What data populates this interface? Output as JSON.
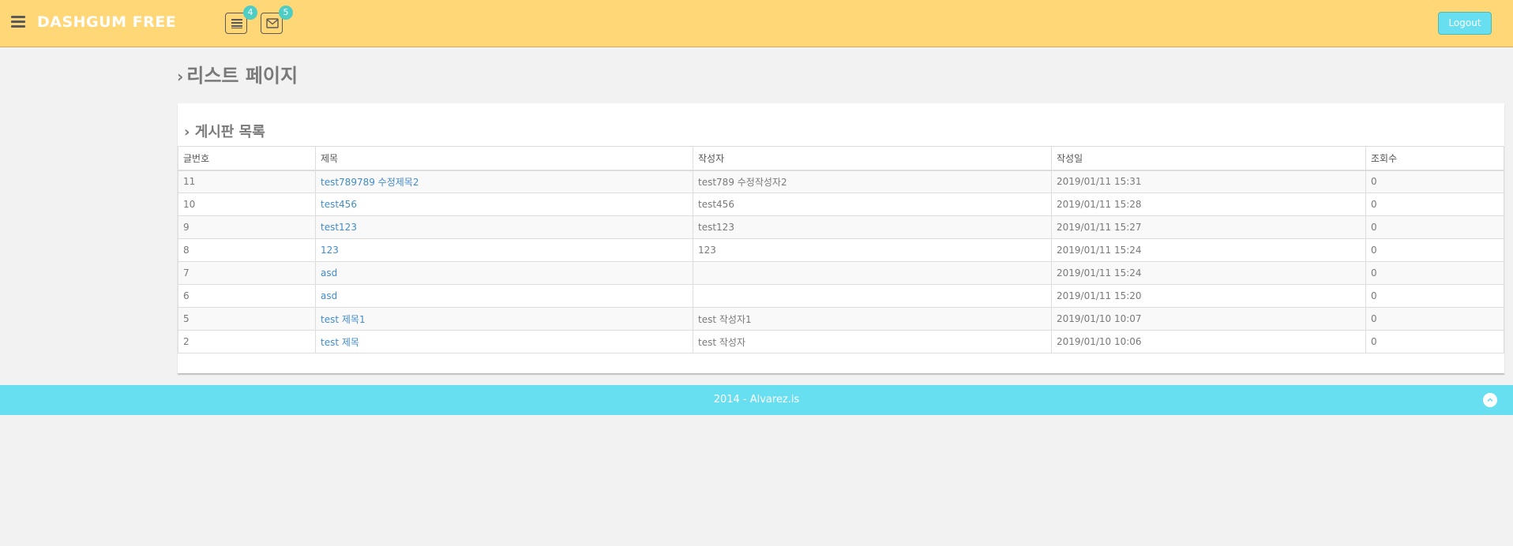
{
  "header": {
    "logo": "DASHGUM FREE",
    "notifications": [
      {
        "icon": "tasks-icon",
        "count": "4"
      },
      {
        "icon": "envelope-icon",
        "count": "5"
      }
    ],
    "logout_label": "Logout"
  },
  "page": {
    "title": "리스트 페이지"
  },
  "panel": {
    "title": "게시판 목록",
    "columns": [
      "글번호",
      "제목",
      "작성자",
      "작성일",
      "조회수"
    ],
    "rows": [
      {
        "no": "11",
        "title": "test789789 수정제목2",
        "author": "test789 수정작성자2",
        "date": "2019/01/11 15:31",
        "views": "0"
      },
      {
        "no": "10",
        "title": "test456",
        "author": "test456",
        "date": "2019/01/11 15:28",
        "views": "0"
      },
      {
        "no": "9",
        "title": "test123",
        "author": "test123",
        "date": "2019/01/11 15:27",
        "views": "0"
      },
      {
        "no": "8",
        "title": "123",
        "author": "123",
        "date": "2019/01/11 15:24",
        "views": "0"
      },
      {
        "no": "7",
        "title": "asd",
        "author": "",
        "date": "2019/01/11 15:24",
        "views": "0"
      },
      {
        "no": "6",
        "title": "asd",
        "author": "",
        "date": "2019/01/11 15:20",
        "views": "0"
      },
      {
        "no": "5",
        "title": "test 제목1",
        "author": "test 작성자1",
        "date": "2019/01/10 10:07",
        "views": "0"
      },
      {
        "no": "2",
        "title": "test 제목",
        "author": "test 작성자",
        "date": "2019/01/10 10:06",
        "views": "0"
      }
    ]
  },
  "footer": {
    "text": "2014 - Alvarez.is"
  },
  "colors": {
    "header_bg": "#ffd777",
    "accent": "#68dff0",
    "link": "#428bca"
  }
}
